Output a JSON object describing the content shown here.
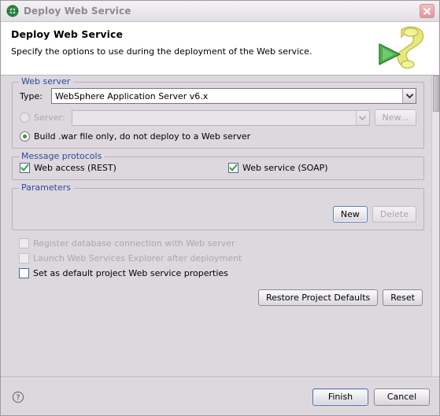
{
  "window": {
    "title": "Deploy Web Service",
    "title_icon": "globe-icon",
    "close_icon": "close-icon"
  },
  "header": {
    "title": "Deploy Web Service",
    "description": "Specify the options to use during the deployment of the Web service.",
    "graphic_icon": "deploy-ribbon-icon"
  },
  "web_server": {
    "legend": "Web server",
    "type_label": "Type:",
    "type_value": "WebSphere Application Server v6.x",
    "type_options": [
      "WebSphere Application Server v6.x"
    ],
    "server_radio_label": "Server:",
    "server_value": "",
    "server_new_button": "New...",
    "build_war_radio_label": "Build .war file only, do not deploy to a Web server",
    "selected_radio": "build_war"
  },
  "message_protocols": {
    "legend": "Message protocols",
    "rest_label": "Web access (REST)",
    "rest_checked": true,
    "soap_label": "Web service (SOAP)",
    "soap_checked": true
  },
  "parameters": {
    "legend": "Parameters",
    "new_button": "New",
    "delete_button": "Delete"
  },
  "options": [
    {
      "label": "Register database connection with Web server",
      "checked": false,
      "enabled": false
    },
    {
      "label": "Launch Web Services Explorer after deployment",
      "checked": false,
      "enabled": false
    },
    {
      "label": "Set as default project Web service properties",
      "checked": false,
      "enabled": true
    }
  ],
  "action_buttons": {
    "restore_defaults": "Restore Project Defaults",
    "reset": "Reset"
  },
  "footer": {
    "help_icon": "help-question-icon",
    "finish_button": "Finish",
    "cancel_button": "Cancel"
  },
  "colors": {
    "dialog_background": "#ddd8de",
    "group_label": "#2b4a9b",
    "header_background": "#ffffff",
    "close_button": "#e8aaaa",
    "radio_dot": "#2f9c3a",
    "check_mark": "#3c9a3c",
    "default_button_border": "#4b6fae"
  }
}
